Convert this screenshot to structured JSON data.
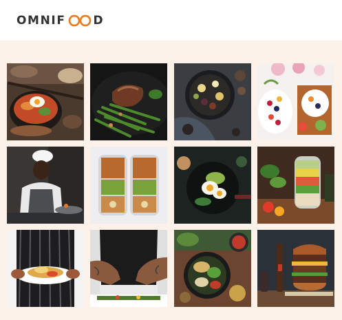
{
  "header": {
    "logo_text_before": "OMNIF",
    "logo_text_after": "D",
    "logo_mark_icon": "double-o-rings",
    "logo_mark_color": "#e67e22"
  },
  "gallery": {
    "items": [
      {
        "name": "bibimbap-bowl"
      },
      {
        "name": "steak-green-beans"
      },
      {
        "name": "food-plate-topdown"
      },
      {
        "name": "fruit-breakfast-spread"
      },
      {
        "name": "chef-cooking"
      },
      {
        "name": "meal-prep-containers"
      },
      {
        "name": "avocado-egg-plate"
      },
      {
        "name": "salad-jar"
      },
      {
        "name": "waiter-serving-plate"
      },
      {
        "name": "chef-plating"
      },
      {
        "name": "grain-bowl-table"
      },
      {
        "name": "burger-stack"
      }
    ]
  },
  "colors": {
    "page_background": "#fdf2e9",
    "header_background": "#ffffff",
    "logo_text": "#333333",
    "brand_accent": "#e67e22"
  }
}
